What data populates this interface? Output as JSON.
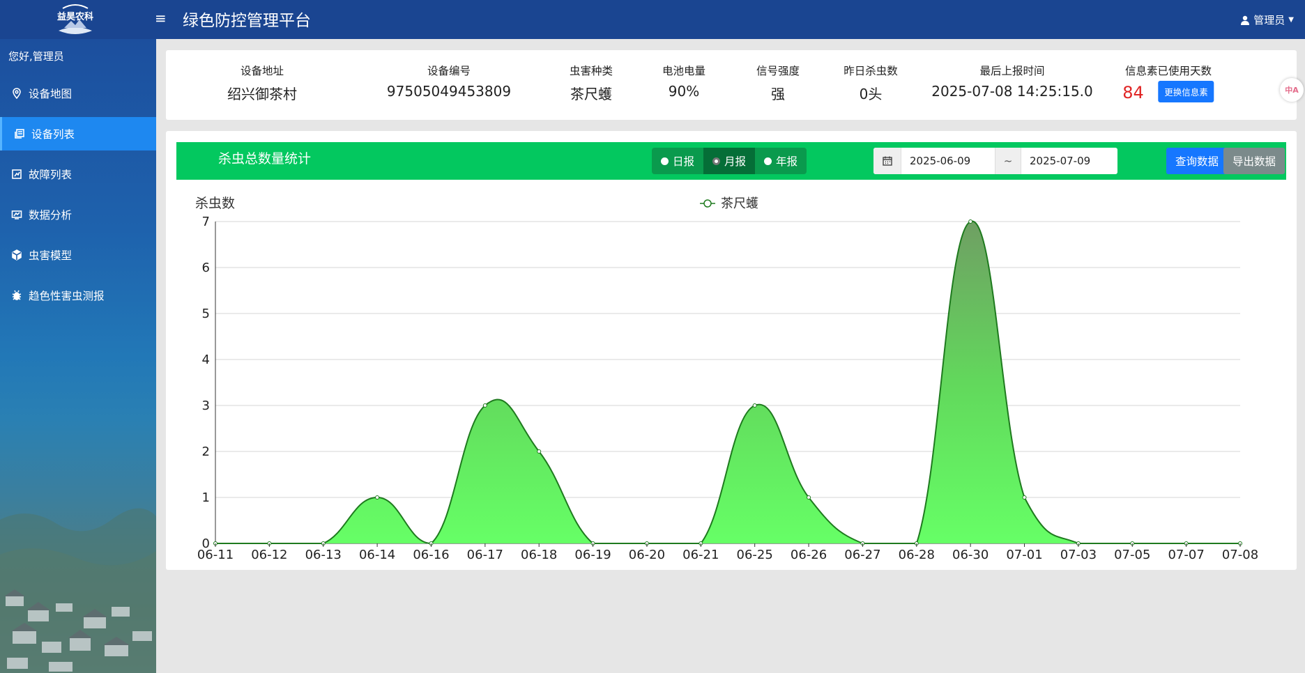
{
  "header": {
    "logo_text": "益昊农科",
    "menu_icon": "hamburger-icon",
    "title": "绿色防控管理平台",
    "user_label": "管理员",
    "user_icon": "user-icon",
    "caret_icon": "caret-down-icon"
  },
  "sidebar": {
    "greeting": "您好,管理员",
    "items": [
      {
        "label": "设备地图",
        "icon": "map-pin-icon",
        "active": false
      },
      {
        "label": "设备列表",
        "icon": "list-icon",
        "active": true
      },
      {
        "label": "故障列表",
        "icon": "report-icon",
        "active": false
      },
      {
        "label": "数据分析",
        "icon": "analytics-icon",
        "active": false
      },
      {
        "label": "虫害模型",
        "icon": "cube-icon",
        "active": false
      },
      {
        "label": "趋色性害虫测报",
        "icon": "bug-icon",
        "active": false
      }
    ]
  },
  "device_info": {
    "address_label": "设备地址",
    "address": "绍兴御茶村",
    "id_label": "设备编号",
    "id": "97505049453809",
    "pest_label": "虫害种类",
    "pest": "茶尺蠖",
    "battery_label": "电池电量",
    "battery": "90%",
    "signal_label": "信号强度",
    "signal": "强",
    "kills_label": "昨日杀虫数",
    "kills": "0头",
    "report_time_label": "最后上报时间",
    "report_time": "2025-07-08 14:25:15.0",
    "days_label": "信息素已使用天数",
    "days": "84",
    "change_button": "更换信息素"
  },
  "side_float": {
    "text": "中A"
  },
  "chart_toolbar": {
    "title": "杀虫总数量统计",
    "periods": [
      {
        "label": "日报",
        "active": false
      },
      {
        "label": "月报",
        "active": true
      },
      {
        "label": "年报",
        "active": false
      }
    ],
    "calendar_icon": "calendar-icon",
    "date_from": "2025-06-09",
    "date_sep": "~",
    "date_to": "2025-07-09",
    "query_button": "查询数据",
    "export_button": "导出数据"
  },
  "colors": {
    "header_bg": "#1a4591",
    "sidebar_active": "#1e88f0",
    "toolbar_bg": "#03c85f",
    "primary_button": "#1677ff",
    "secondary_button": "#7b8a8b",
    "highlight_red": "#e02424",
    "series_line": "#1e7a1e",
    "series_fill_top": "#6fa86a",
    "series_fill_bottom": "#66ff66"
  },
  "chart_data": {
    "type": "area",
    "ylabel": "杀虫数",
    "xlabel": "",
    "categories": [
      "06-11",
      "06-12",
      "06-13",
      "06-14",
      "06-16",
      "06-17",
      "06-18",
      "06-19",
      "06-20",
      "06-21",
      "06-25",
      "06-26",
      "06-27",
      "06-28",
      "06-30",
      "07-01",
      "07-03",
      "07-05",
      "07-07",
      "07-08"
    ],
    "series": [
      {
        "name": "茶尺蠖",
        "values": [
          0,
          0,
          0,
          1,
          0,
          3,
          2,
          0,
          0,
          0,
          3,
          1,
          0,
          0,
          7,
          1,
          0,
          0,
          0,
          0
        ]
      }
    ],
    "ylim": [
      0,
      7
    ],
    "yticks": [
      0,
      1,
      2,
      3,
      4,
      5,
      6,
      7
    ],
    "smooth": true,
    "grid": "horizontal",
    "legend": "top-center"
  }
}
